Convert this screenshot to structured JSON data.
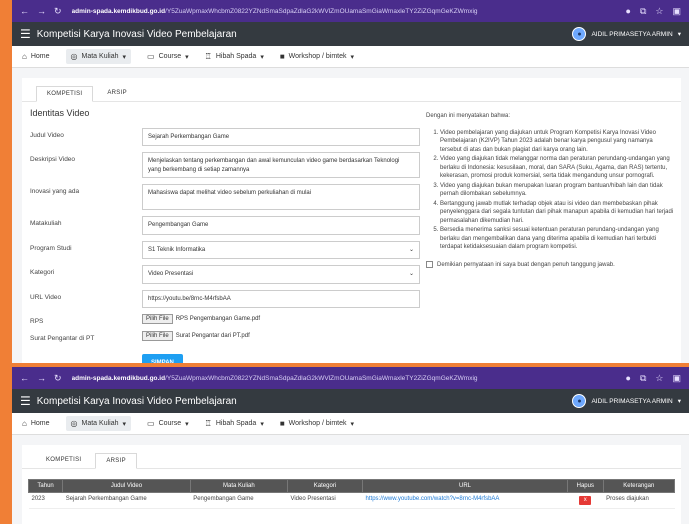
{
  "browser": {
    "url_host": "admin-spada.kemdikbud.go.id",
    "url_path": "/Y5ZuaWpmaxWhcbmZ0822YZNdSmaSdpaZdlaG2kWVlZmOUamaSmGiaWmaxleTY2ZiZGqmGeKZWmxig"
  },
  "header": {
    "title": "Kompetisi Karya Inovasi Video Pembelajaran",
    "user": "AIDIL PRIMASETYA ARMIN"
  },
  "menu": {
    "home": "Home",
    "mata_kuliah": "Mata Kuliah",
    "course": "Course",
    "hibah": "Hibah Spada",
    "workshop": "Workshop / bimtek"
  },
  "tabs": {
    "kompetisi": "KOMPETISI",
    "arsip": "ARSIP"
  },
  "form": {
    "title": "Identitas Video",
    "judul_label": "Judul Video",
    "judul_value": "Sejarah Perkembangan Game",
    "deskripsi_label": "Deskripsi Video",
    "deskripsi_value": "Menjelaskan tentang perkembangan dan awal kemunculan video game berdasarkan Teknologi yang berkembang di setiap zamannya",
    "inovasi_label": "Inovasi yang ada",
    "inovasi_value": "Mahasiswa dapat melihat video sebelum perkuliahan di mulai",
    "matakuliah_label": "Matakuliah",
    "matakuliah_value": "Pengembangan Game",
    "prodi_label": "Program Studi",
    "prodi_value": "S1 Teknik Informatika",
    "kategori_label": "Kategori",
    "kategori_value": "Video Presentasi",
    "url_label": "URL Video",
    "url_value": "https://youtu.be/8rnc-M4rfsbAA",
    "rps_label": "RPS",
    "rps_button": "Pilih File",
    "rps_file": "RPS Pengembangan Game.pdf",
    "surat_label": "Surat Pengantar di PT",
    "surat_button": "Pilih File",
    "surat_file": "Surat Pengantar dari PT.pdf",
    "save": "SIMPAN"
  },
  "declaration": {
    "intro": "Dengan ini menyatakan bahwa:",
    "items": [
      "Video pembelajaran yang diajukan untuk Program Kompetisi Karya Inovasi Video Pembelajaran (K2IVP) Tahun 2023 adalah benar karya pengusul yang namanya tersebut di atas dan bukan plagiat dari karya orang lain.",
      "Video yang diajukan tidak melanggar norma dan peraturan perundang-undangan yang berlaku di Indonesia: kesusilaan, moral, dan SARA (Suku, Agama, dan RAS) tertentu, kekerasan, promosi produk komersial, serta tidak mengandung unsur pornografi.",
      "Video yang diajukan bukan merupakan luaran program bantuan/hibah lain dan tidak pernah dilombakan sebelumnya.",
      "Bertanggung jawab mutlak terhadap objek atau isi video dan membebaskan pihak penyelenggara dari segala tuntutan dari pihak manapun apabila di kemudian hari terjadi permasalahan dikemudian hari.",
      "Bersedia menerima sanksi sesuai ketentuan peraturan perundang-undangan yang berlaku dan mengembalikan dana yang diterima apabila di kemudian hari terbukti terdapat ketidaksesuaian dalam program kompetisi."
    ],
    "agree": "Demikian pernyataan ini saya buat dengan penuh tanggung jawab."
  },
  "archive_table": {
    "headers": [
      "Tahun",
      "Judul Video",
      "Mata Kuliah",
      "Kategori",
      "URL",
      "Hapus",
      "Keterangan"
    ],
    "rows": [
      {
        "tahun": "2023",
        "judul": "Sejarah Perkembangan Game",
        "matkul": "Pengembangan Game",
        "kategori": "Video Presentasi",
        "url": "https://www.youtube.com/watch?v=8rnc-M4rfsbAA",
        "hapus": "x",
        "keterangan": "Proses diajukan"
      }
    ]
  },
  "colors": {
    "frame": "#f07f36",
    "browser": "#4a2d8c",
    "header": "#343a40",
    "save": "#1e9ff2"
  }
}
